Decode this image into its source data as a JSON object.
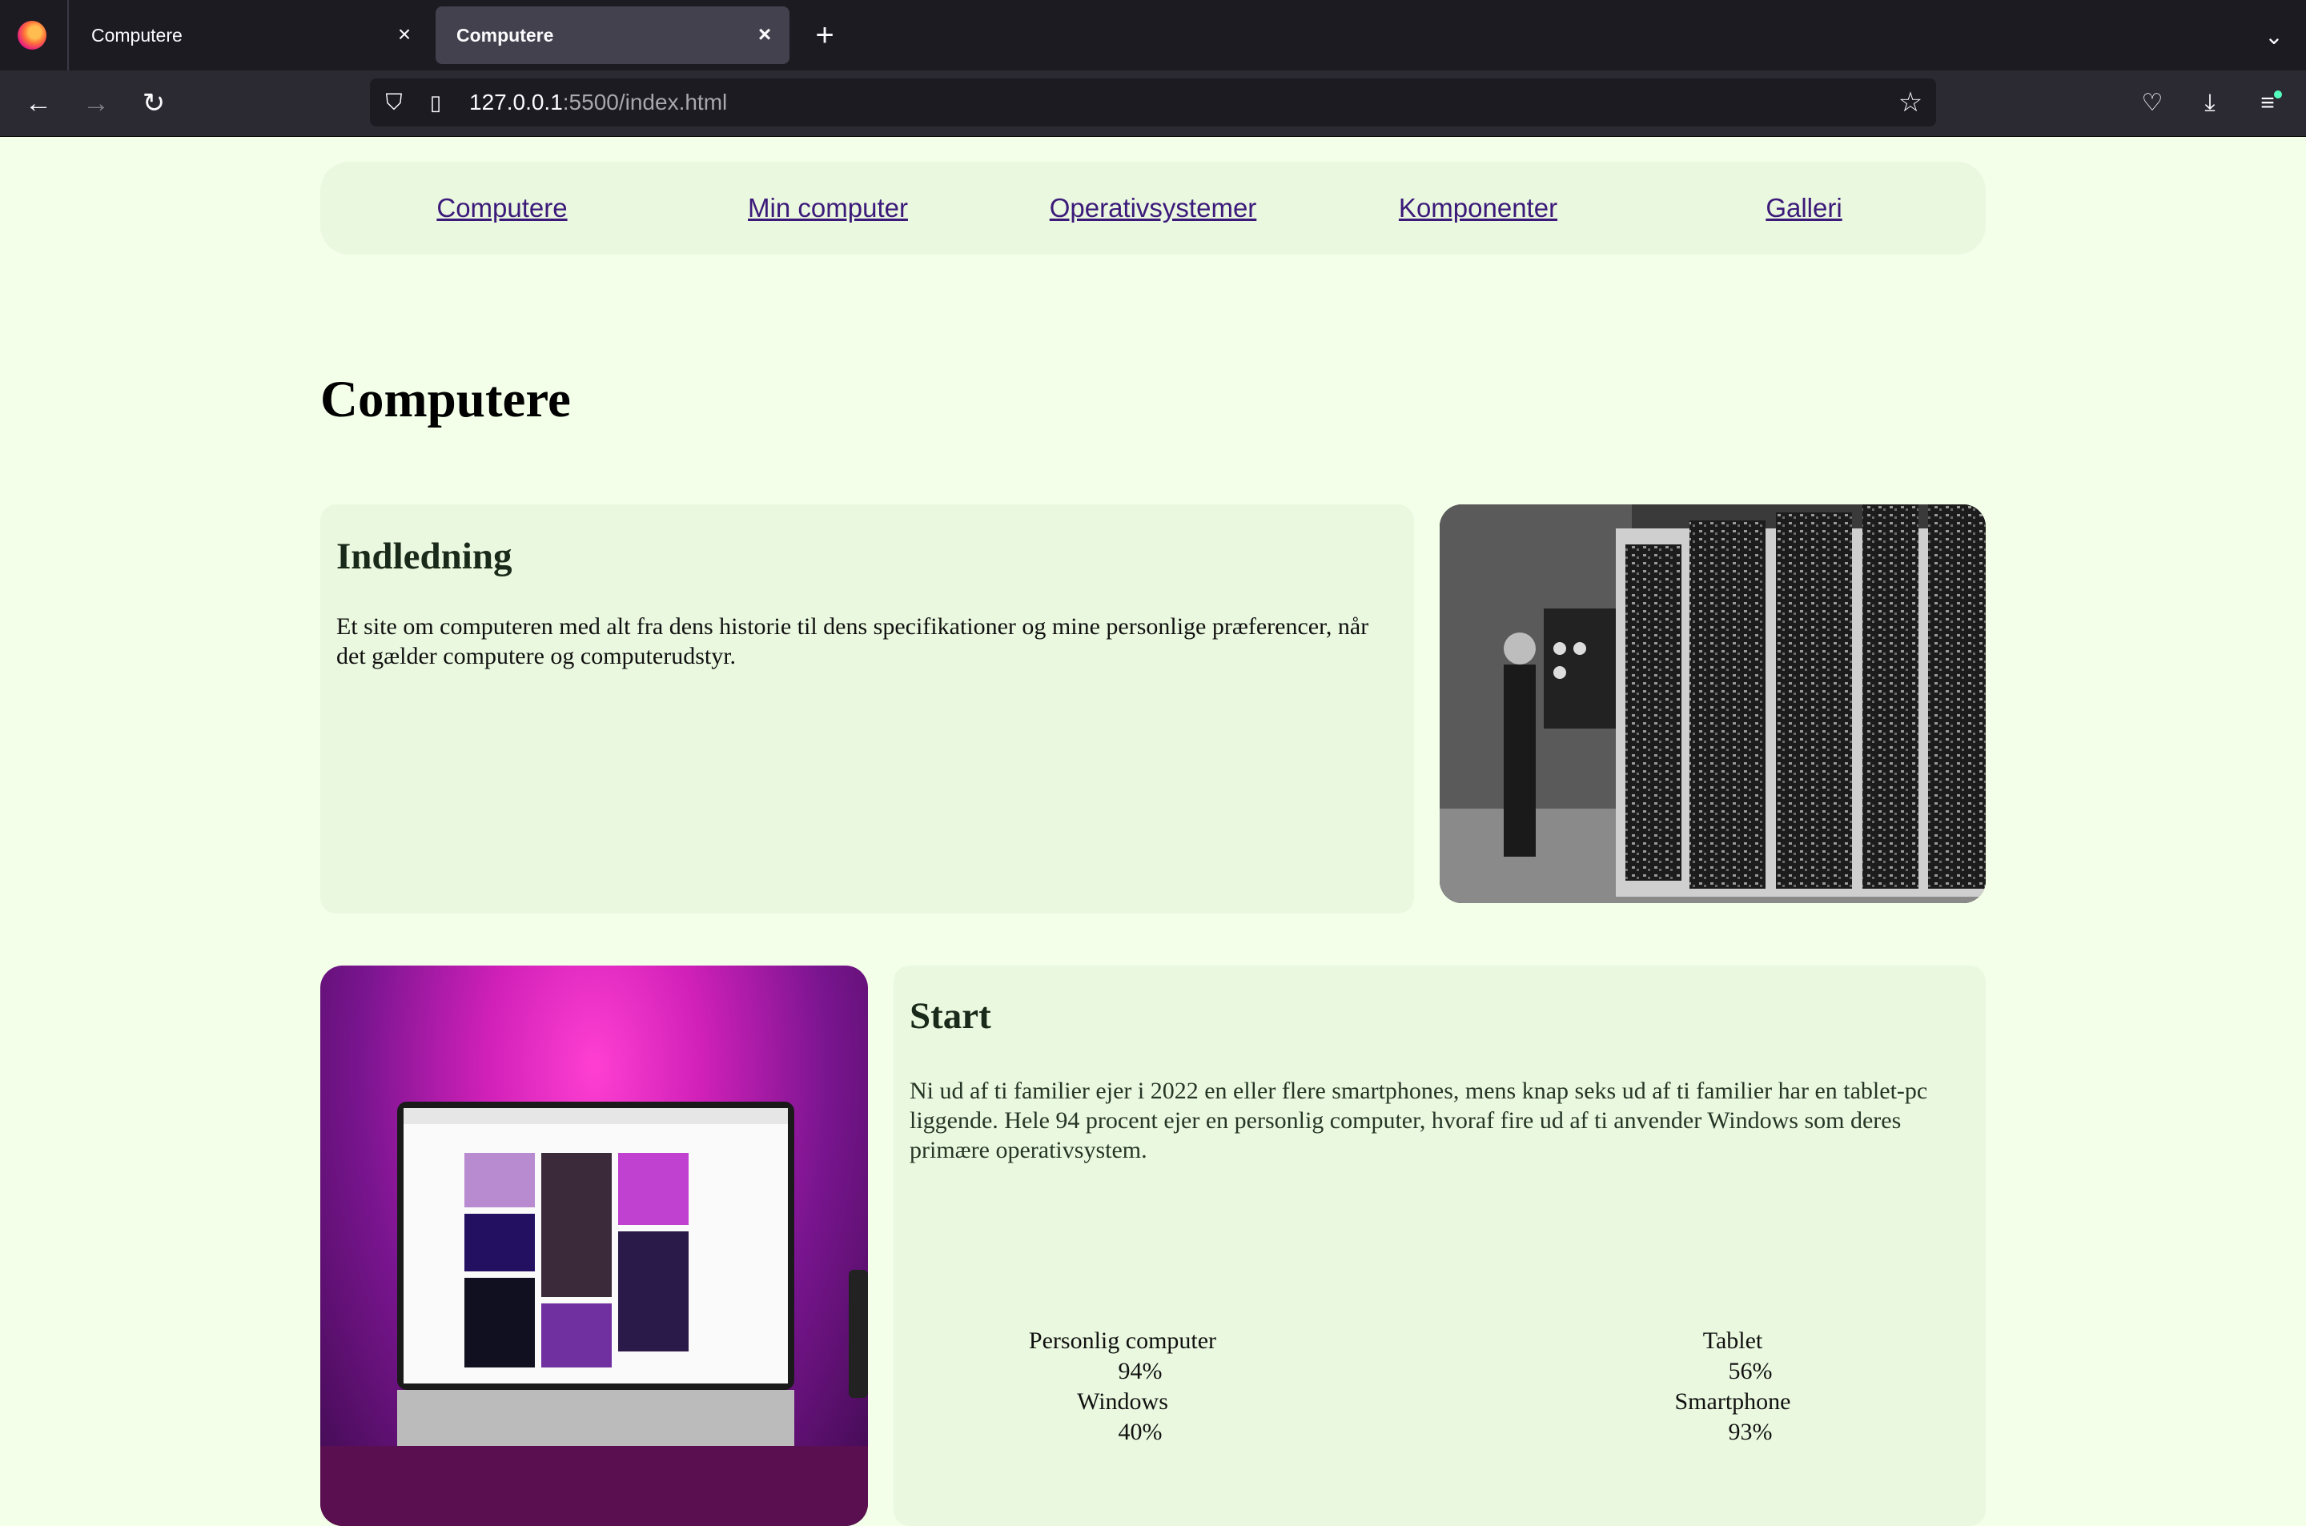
{
  "browser": {
    "tabs": [
      {
        "title": "Computere",
        "active": false
      },
      {
        "title": "Computere",
        "active": true
      }
    ],
    "url_host": "127.0.0.1",
    "url_rest": ":5500/index.html"
  },
  "nav": {
    "links": [
      "Computere",
      "Min computer",
      "Operativsystemer",
      "Komponenter",
      "Galleri"
    ]
  },
  "page": {
    "title": "Computere"
  },
  "intro": {
    "heading": "Indledning",
    "text": "Et site om computeren med alt fra dens historie til dens specifikationer og mine personlige præferencer, når det gælder computere og computerudstyr."
  },
  "start": {
    "heading": "Start",
    "text": "Ni ud af ti familier ejer i 2022 en eller flere smartphones, mens knap seks ud af ti familier har en tablet-pc liggende. Hele 94 procent ejer en personlig computer, hvoraf fire ud af ti anvender Windows som deres primære operativsystem.",
    "stats": [
      {
        "label": "Personlig computer",
        "value": "94%"
      },
      {
        "label": "Windows",
        "value": "40%"
      },
      {
        "label": "Tablet",
        "value": "56%"
      },
      {
        "label": "Smartphone",
        "value": "93%"
      }
    ]
  },
  "colors": {
    "page_bg": "#f3ffe9",
    "card_bg": "#eaf8df",
    "link": "#3b1a7a"
  }
}
